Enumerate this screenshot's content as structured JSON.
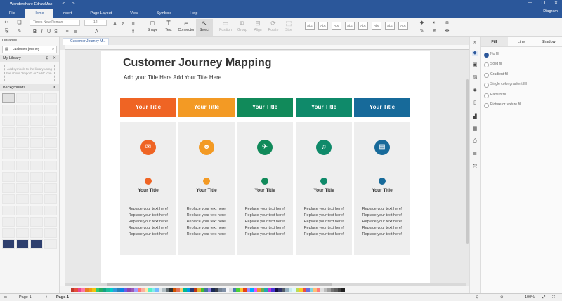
{
  "app": {
    "title": "Wondershare EdrawMax"
  },
  "titlebar": {
    "undo": "↶",
    "redo": "↷",
    "minimize": "—",
    "restore": "❐",
    "close": "✕"
  },
  "menu": {
    "file": "File",
    "tabs": [
      "Home",
      "Insert",
      "Page Layout",
      "View",
      "Symbols",
      "Help"
    ],
    "active_tab": "Home",
    "diagram_label": "Diagram"
  },
  "toolbar": {
    "font_name": "Times New Roman",
    "font_size": "12",
    "tools": [
      {
        "label": "Shape",
        "icon": "shape-icon",
        "disabled": false
      },
      {
        "label": "Text",
        "icon": "text-icon",
        "disabled": false
      },
      {
        "label": "Connector",
        "icon": "connector-icon",
        "disabled": false
      },
      {
        "label": "Select",
        "icon": "select-icon",
        "disabled": false,
        "selected": true
      },
      {
        "label": "Position",
        "icon": "position-icon",
        "disabled": true
      },
      {
        "label": "Group",
        "icon": "group-icon",
        "disabled": true
      },
      {
        "label": "Align",
        "icon": "align-icon",
        "disabled": true
      },
      {
        "label": "Rotate",
        "icon": "rotate-icon",
        "disabled": true
      },
      {
        "label": "Size",
        "icon": "size-icon",
        "disabled": true
      }
    ],
    "style_label": "Abc"
  },
  "left_panel": {
    "title": "Libraries",
    "search_value": "customer journey",
    "my_library": "My Library",
    "drop_hint": "Add symbols to the library using the above \"Import\" or \"Add\" icon.",
    "backgrounds": "Backgrounds"
  },
  "document": {
    "tab_name": "Customer Journey M...",
    "main_title": "Customer Journey Mapping",
    "subtitle": "Add your Title Here   Add Your Title Here",
    "columns": [
      {
        "header": "Your Title",
        "color": "#ef6424",
        "icon": "email-icon",
        "glyph": "✉",
        "subtitle": "Your Title",
        "lines": [
          "Replace your text here!",
          "Replace your text here!",
          "Replace your text here!",
          "Replace your text here!",
          "Replace your text here!"
        ]
      },
      {
        "header": "Your Title",
        "color": "#f39a24",
        "icon": "people-icon",
        "glyph": "👥",
        "subtitle": "Your Title",
        "lines": [
          "Replace your text here!",
          "Replace your text here!",
          "Replace your text here!",
          "Replace your text here!",
          "Replace your text here!"
        ]
      },
      {
        "header": "Your Title",
        "color": "#118a5a",
        "icon": "airplane-icon",
        "glyph": "✈",
        "subtitle": "Your Title",
        "lines": [
          "Replace your text here!",
          "Replace your text here!",
          "Replace your text here!",
          "Replace your text here!",
          "Replace your text here!"
        ]
      },
      {
        "header": "Your Title",
        "color": "#0f8a6a",
        "icon": "music-icon",
        "glyph": "♫",
        "subtitle": "Your Title",
        "lines": [
          "Replace your text here!",
          "Replace your text here!",
          "Replace your text here!",
          "Replace your text here!",
          "Replace your text here!"
        ]
      },
      {
        "header": "Your Title",
        "color": "#176a9a",
        "icon": "book-icon",
        "glyph": "📘",
        "subtitle": "Your Title",
        "lines": [
          "Replace your text here!",
          "Replace your text here!",
          "Replace your text here!",
          "Replace your text here!",
          "Replace your text here!"
        ]
      }
    ]
  },
  "fill_panel": {
    "tabs": [
      "Fill",
      "Line",
      "Shadow"
    ],
    "active_tab": "Fill",
    "options": [
      "No fill",
      "Solid fill",
      "Gradient fill",
      "Single color gradient fill",
      "Pattern fill",
      "Picture or texture fill"
    ],
    "checked": "No fill"
  },
  "statusbar": {
    "page_select": "Page-1",
    "page_tab": "Page-1",
    "add_page": "+",
    "zoom": "100%"
  },
  "palette": [
    "#c0392b",
    "#e74c3c",
    "#e84393",
    "#fd79a8",
    "#e67e22",
    "#f39c12",
    "#f1c40f",
    "#2ecc71",
    "#27ae60",
    "#16a085",
    "#1abc9c",
    "#00cec9",
    "#3498db",
    "#2980b9",
    "#0984e3",
    "#6c5ce7",
    "#8e44ad",
    "#9b59b6",
    "#a29bfe",
    "#ff7675",
    "#fab1a0",
    "#ffeaa7",
    "#55efc4",
    "#81ecec",
    "#74b9ff",
    "#dfe6e9",
    "#b2bec3",
    "#636e72",
    "#2d3436",
    "#d35400",
    "#e17055",
    "#fdcb6e",
    "#00b894",
    "#0097e6",
    "#273c75",
    "#c23616",
    "#e1b12c",
    "#44bd32",
    "#40739e",
    "#8c7ae6",
    "#192a56",
    "#353b48",
    "#718093",
    "#7f8fa6",
    "#f5f6fa",
    "#dcdde1",
    "#487eb0",
    "#4cd137",
    "#fbc531",
    "#e84118",
    "#9c88ff",
    "#00a8ff",
    "#e056fd",
    "#f0932b",
    "#6ab04c",
    "#22a6b3",
    "#be2edd",
    "#4834d4",
    "#130f40",
    "#30336b",
    "#535c68",
    "#95afc0",
    "#c7ecee",
    "#dff9fb",
    "#badc58",
    "#f9ca24",
    "#eb4d4b",
    "#686de0",
    "#7ed6df",
    "#ffbe76",
    "#ff7979",
    "#e0e0e0",
    "#bdbdbd",
    "#9e9e9e",
    "#757575",
    "#616161",
    "#424242",
    "#212121"
  ]
}
